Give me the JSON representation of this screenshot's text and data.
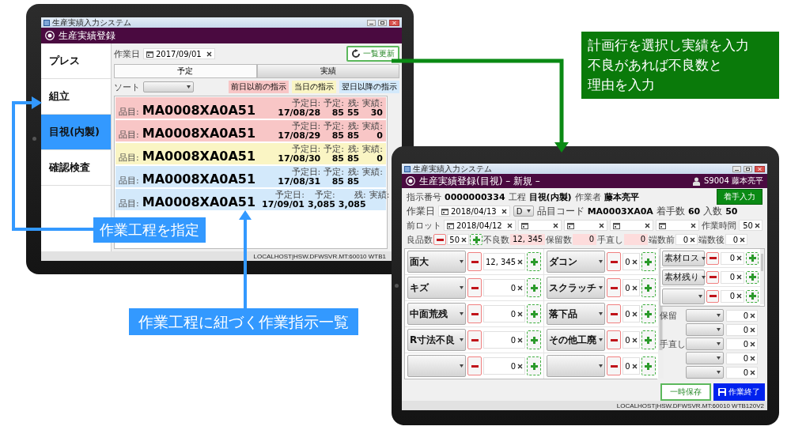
{
  "tablet_1": {
    "window": {
      "title": "生産実績入力システム",
      "header": "生産実績登録"
    },
    "processes": [
      {
        "label": "プレス",
        "selected": false
      },
      {
        "label": "組立",
        "selected": false
      },
      {
        "label": "目視(内製)",
        "selected": true
      },
      {
        "label": "確認検査",
        "selected": false
      }
    ],
    "work_date": {
      "label": "作業日",
      "value": "2017/09/01"
    },
    "refresh_button": "一覧更新",
    "tabs": [
      {
        "label": "予定",
        "selected": true
      },
      {
        "label": "実績",
        "selected": false
      }
    ],
    "sort": {
      "label": "ソート"
    },
    "legend": [
      {
        "label": "前日以前の指示",
        "color": "#f8c6c6"
      },
      {
        "label": "当日の指示",
        "color": "#faf5c4"
      },
      {
        "label": "翌日以降の指示",
        "color": "#d3e9fb"
      }
    ],
    "orders": [
      {
        "item_label": "品目:",
        "code": "MA0008XA0A51",
        "date_label": "予定日:",
        "date": "17/08/28",
        "planned_label": "予定:",
        "planned": "85",
        "remaining_label": "残:",
        "remaining": "55",
        "actual_label": "実績:",
        "actual": "30",
        "color": "#f8c6c6"
      },
      {
        "item_label": "品目:",
        "code": "MA0008XA0A51",
        "date_label": "予定日:",
        "date": "17/08/29",
        "planned_label": "予定:",
        "planned": "85",
        "remaining_label": "残:",
        "remaining": "85",
        "actual_label": "実績:",
        "actual": "0",
        "color": "#f8c6c6"
      },
      {
        "item_label": "品目:",
        "code": "MA0008XA0A51",
        "date_label": "予定日:",
        "date": "17/08/30",
        "planned_label": "予定:",
        "planned": "85",
        "remaining_label": "残:",
        "remaining": "85",
        "actual_label": "実績:",
        "actual": "0",
        "color": "#faf5c4"
      },
      {
        "item_label": "品目:",
        "code": "MA0008XA0A51",
        "date_label": "予定日:",
        "date": "17/08/31",
        "planned_label": "予定:",
        "planned": "85",
        "remaining_label": "残:",
        "remaining": "85",
        "actual_label": "実績:",
        "color": "#d3e9fb"
      },
      {
        "item_label": "品目:",
        "code": "MA0008XA0A51",
        "date_label": "予定日:",
        "date": "17/09/01",
        "planned_label": "予定:",
        "planned": "3,085",
        "remaining_label": "残:",
        "remaining": "3,085",
        "actual_label": "実績:",
        "color": "#d3e9fb"
      }
    ],
    "status_bar": "LOCALHOST|HSW.DFWSVR.MT:60010 WTB1"
  },
  "tablet_2": {
    "window": {
      "title": "生産実績入力システム",
      "header": "生産実績登録(目視) – 新規 –",
      "user": "S9004 藤本亮平"
    },
    "instruction": {
      "label": "指示番号",
      "value": "0000000334"
    },
    "process": {
      "label": "工程",
      "value": "目視(内製)"
    },
    "worker": {
      "label": "作業者",
      "value": "藤本亮平"
    },
    "start_button": "着手入力",
    "work_date": {
      "label": "作業日",
      "value": "2018/04/13"
    },
    "shift": "D",
    "item_code": {
      "label": "品目コード",
      "value": "MA0003XA0A"
    },
    "started": {
      "label": "着手数",
      "value": "60"
    },
    "per_box": {
      "label": "入数",
      "value": "50"
    },
    "prev_lot_label": "前ロット",
    "prev_lots": [
      {
        "kind": "date",
        "value": "2018/04/12"
      },
      {
        "kind": "date"
      },
      {
        "kind": "date"
      },
      {
        "kind": "date"
      },
      {
        "kind": "date"
      }
    ],
    "work_time": {
      "label": "作業時間",
      "value": "50"
    },
    "counts": [
      {
        "kind": "stepper",
        "label": "良品数",
        "value": "50"
      },
      {
        "kind": "readonly",
        "label": "不良数",
        "value": "12, 345"
      },
      {
        "kind": "readonly",
        "label": "保留数",
        "value": "0"
      },
      {
        "kind": "readonly",
        "label": "手直し",
        "value": "0"
      },
      {
        "kind": "clearable",
        "label": "端数前",
        "value": "0"
      },
      {
        "kind": "clearable",
        "label": "端数後",
        "value": "0"
      }
    ],
    "defects": [
      {
        "reason": "面大",
        "value": "12, 345"
      },
      {
        "reason": "ダコン",
        "value": "0"
      },
      {
        "reason": "キズ",
        "value": "0"
      },
      {
        "reason": "スクラッチ",
        "value": "0"
      },
      {
        "reason": "中面荒残",
        "value": "0"
      },
      {
        "reason": "落下品",
        "value": "0"
      },
      {
        "reason": "R寸法不良",
        "value": "0"
      },
      {
        "reason": "その他工廃",
        "value": "0"
      },
      {
        "value": "0"
      },
      {
        "value": "0"
      }
    ],
    "materials": [
      {
        "reason": "素材ロス",
        "value": "0"
      },
      {
        "reason": "素材残り",
        "value": "0"
      },
      {
        "value": "0"
      }
    ],
    "side_groups": [
      {
        "label": "保留",
        "items": [
          {
            "value": "0"
          },
          {
            "value": "0"
          }
        ]
      },
      {
        "label": "手直し",
        "items": [
          {
            "value": "0"
          },
          {
            "value": "0"
          },
          {
            "value": "0"
          }
        ]
      }
    ],
    "save_button": "一時保存",
    "finish_button": "作業終了",
    "status_bar": "LOCALHOST|HSW.DFWSVR.MT:60010 WTB120V2"
  },
  "callouts": {
    "input_hint": {
      "lines": [
        "計画行を選択し実績を入力",
        "不良があれば不良数と",
        "理由を入力"
      ]
    },
    "process_hint": {
      "text": "作業工程を指定"
    },
    "list_hint": {
      "text": "作業工程に紐づく作業指示一覧"
    }
  }
}
